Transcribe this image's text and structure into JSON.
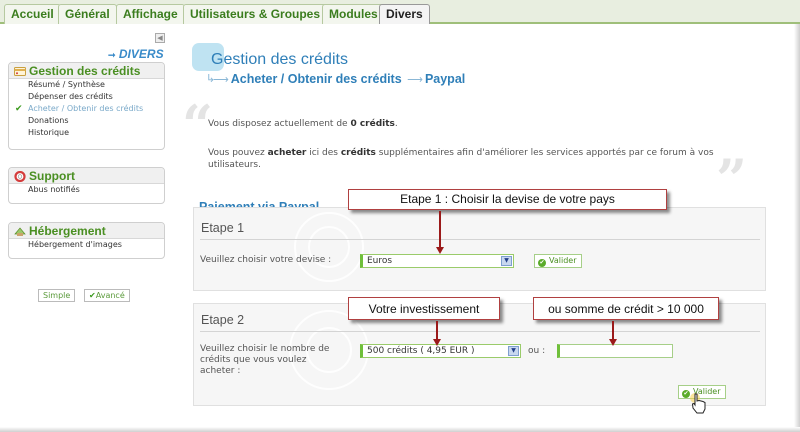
{
  "nav": {
    "tabs": [
      {
        "label": "Accueil"
      },
      {
        "label": "Général"
      },
      {
        "label": "Affichage"
      },
      {
        "label": "Utilisateurs & Groupes"
      },
      {
        "label": "Modules"
      },
      {
        "label": "Divers"
      }
    ],
    "active_tab": "Divers"
  },
  "sidebar": {
    "section_label": "DIVERS",
    "panels": [
      {
        "title": "Gestion des crédits",
        "items": [
          "Résumé / Synthèse",
          "Dépenser des crédits",
          "Acheter / Obtenir des crédits",
          "Donations",
          "Historique"
        ],
        "selected_item": "Acheter / Obtenir des crédits"
      },
      {
        "title": "Support",
        "items": [
          "Abus notifiés"
        ]
      },
      {
        "title": "Hébergement",
        "items": [
          "Hébergement d'images"
        ]
      }
    ],
    "mode_buttons": {
      "simple": "Simple",
      "advanced": "Avancé"
    }
  },
  "main": {
    "title": "Gestion des crédits",
    "breadcrumb": [
      "Acheter / Obtenir des crédits",
      "Paypal"
    ],
    "balance_line": {
      "prefix": "Vous disposez actuellement de ",
      "amount": "0 crédits",
      "suffix": "."
    },
    "intro_line1": {
      "a": "Vous pouvez ",
      "b": "acheter",
      "c": " ici des ",
      "d": "crédits",
      "e": " supplémentaires afin d'améliorer les services apportés par ce forum à vos"
    },
    "intro_line2": "utilisateurs.",
    "payment_title": "Paiement via Paypal",
    "step1": {
      "title": "Etape 1",
      "label": "Veuillez choisir votre devise :",
      "currency_value": "Euros",
      "submit": "Valider"
    },
    "step2": {
      "title": "Etape 2",
      "label": "Veuillez choisir le nombre de crédits que vous voulez acheter :",
      "amount_value": "500 crédits ( 4,95 EUR )",
      "or_label": "ou :",
      "custom_placeholder": "",
      "submit": "Valider"
    }
  },
  "annotations": {
    "callout1": "Etape 1 : Choisir la devise de votre pays",
    "callout2": "Votre investissement",
    "callout3": "ou somme de crédit > 10 000"
  },
  "colors": {
    "accent_green": "#4a8f22",
    "accent_blue": "#2f7fb8",
    "callout_border": "#b04040",
    "arrow": "#9b1a1a"
  }
}
